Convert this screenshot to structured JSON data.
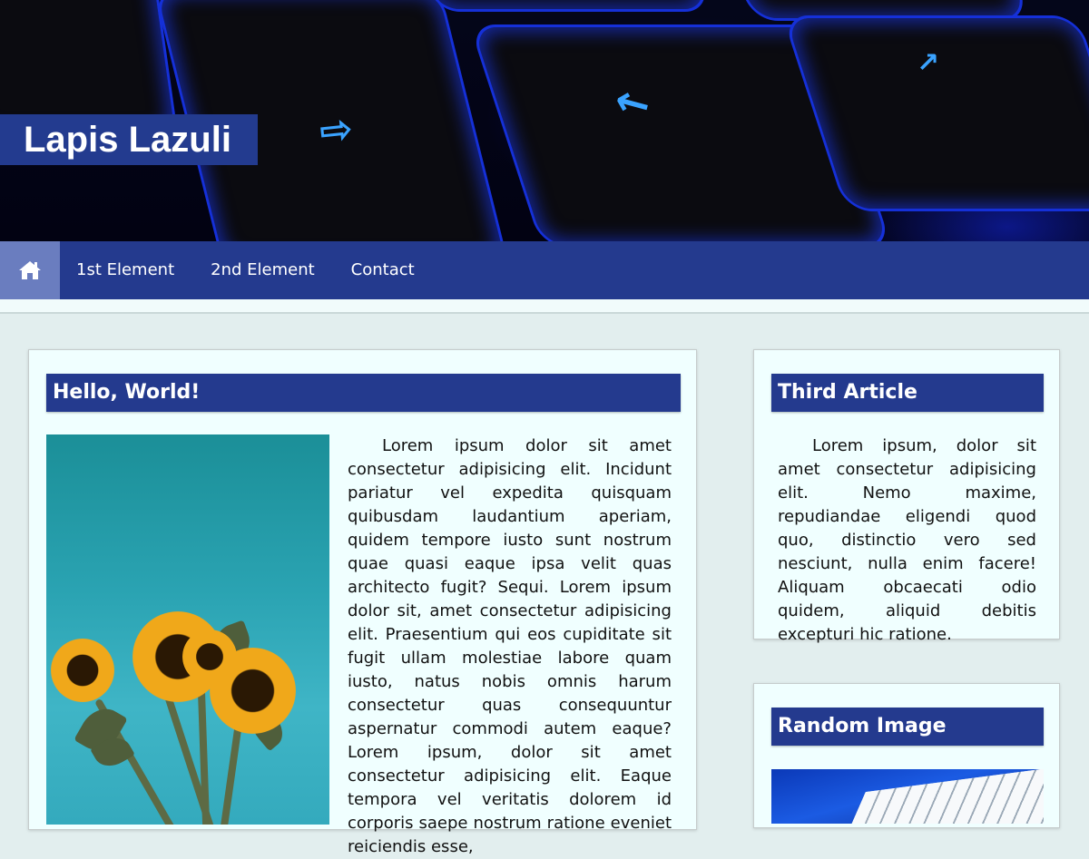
{
  "header": {
    "site_title": "Lapis Lazuli",
    "hero_image": "backlit-keyboard-arrow-keys"
  },
  "nav": {
    "home_icon": "home-icon",
    "items": [
      {
        "label": "1st Element"
      },
      {
        "label": "2nd Element"
      },
      {
        "label": "Contact"
      }
    ]
  },
  "main_article": {
    "title": "Hello, World!",
    "image": "sunflowers-on-teal-wall",
    "body": "Lorem ipsum dolor sit amet consectetur adipisicing elit. Incidunt pariatur vel expedita quisquam quibusdam laudantium aperiam, quidem tempore iusto sunt nostrum quae quasi eaque ipsa velit quas architecto fugit? Sequi. Lorem ipsum dolor sit, amet consectetur adipisicing elit. Praesentium qui eos cupiditate sit fugit ullam molestiae labore quam iusto, natus nobis omnis harum consectetur quas consequuntur aspernatur commodi autem eaque? Lorem ipsum, dolor sit amet consectetur adipisicing elit. Eaque tempora vel veritatis dolorem id corporis saepe nostrum ratione eveniet reiciendis esse,"
  },
  "sidebar": {
    "third_article": {
      "title": "Third Article",
      "body": "Lorem ipsum, dolor sit amet consectetur adipisicing elit. Nemo maxime, repudiandae eligendi quod quo, distinctio vero sed nesciunt, nulla enim facere! Aliquam obcaecati odio quidem, aliquid debitis excepturi hic ratione."
    },
    "random_image": {
      "title": "Random Image",
      "image": "blue-laptop-keyboard"
    }
  },
  "colors": {
    "accent": "#243a8e",
    "home_active": "#6a7dbf",
    "page_bg": "#e2eeee",
    "card_bg": "#f0ffff"
  }
}
